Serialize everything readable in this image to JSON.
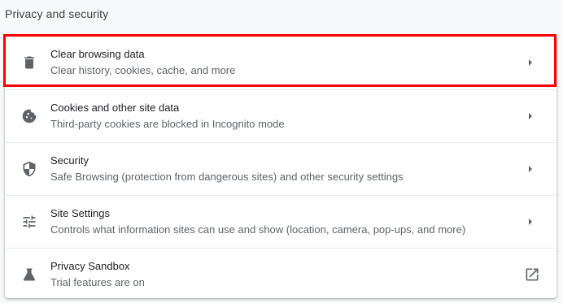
{
  "section": {
    "title": "Privacy and security"
  },
  "rows": [
    {
      "label": "Clear browsing data",
      "sublabel": "Clear history, cookies, cache, and more",
      "icon": "trash-icon",
      "trailing_icon": "chevron-right-icon"
    },
    {
      "label": "Cookies and other site data",
      "sublabel": "Third-party cookies are blocked in Incognito mode",
      "icon": "cookie-icon",
      "trailing_icon": "chevron-right-icon"
    },
    {
      "label": "Security",
      "sublabel": "Safe Browsing (protection from dangerous sites) and other security settings",
      "icon": "shield-icon",
      "trailing_icon": "chevron-right-icon"
    },
    {
      "label": "Site Settings",
      "sublabel": "Controls what information sites can use and show (location, camera, pop-ups, and more)",
      "icon": "tune-icon",
      "trailing_icon": "chevron-right-icon"
    },
    {
      "label": "Privacy Sandbox",
      "sublabel": "Trial features are on",
      "icon": "flask-icon",
      "trailing_icon": "open-in-new-icon"
    }
  ],
  "highlight": {
    "color": "#ff0000",
    "target": "Clear browsing data"
  },
  "colors": {
    "page_background": "#f8f9fa",
    "card_background": "#ffffff",
    "primary_text": "#202124",
    "secondary_text": "#5f6368",
    "divider": "#e8eaed"
  }
}
